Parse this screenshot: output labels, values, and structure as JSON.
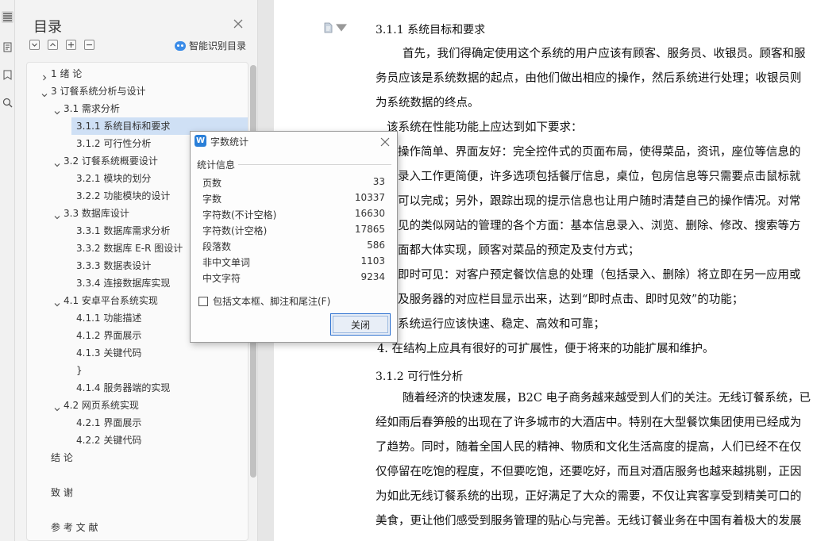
{
  "nav": {
    "title": "目录",
    "smart_label": "智能识别目录"
  },
  "toc": [
    {
      "label": "1  绪  论",
      "level": 0,
      "expanded": false
    },
    {
      "label": "3  订餐系统分析与设计",
      "level": 0,
      "expanded": true
    },
    {
      "label": "3.1 需求分析",
      "level": 1,
      "expanded": true
    },
    {
      "label": "3.1.1  系统目标和要求",
      "level": 2,
      "selected": true
    },
    {
      "label": "3.1.2  可行性分析",
      "level": 2
    },
    {
      "label": "3.2  订餐系统概要设计",
      "level": 1,
      "expanded": true
    },
    {
      "label": "3.2.1  模块的划分",
      "level": 2
    },
    {
      "label": "3.2.2  功能模块的设计",
      "level": 2
    },
    {
      "label": "3.3  数据库设计",
      "level": 1,
      "expanded": true
    },
    {
      "label": "3.3.1  数据库需求分析",
      "level": 2
    },
    {
      "label": "3.3.2  数据库 E-R 图设计",
      "level": 2
    },
    {
      "label": "3.3.3  数据表设计",
      "level": 2
    },
    {
      "label": "3.3.4  连接数据库实现",
      "level": 2
    },
    {
      "label": "4.1 安卓平台系统实现",
      "level": 1,
      "expanded": true
    },
    {
      "label": "4.1.1  功能描述",
      "level": 2
    },
    {
      "label": "4.1.2  界面展示",
      "level": 2
    },
    {
      "label": "4.1.3  关键代码",
      "level": 2
    },
    {
      "label": "}",
      "level": 2
    },
    {
      "label": "4.1.4  服务器端的实现",
      "level": 2
    },
    {
      "label": "4.2  网页系统实现",
      "level": 1,
      "expanded": true
    },
    {
      "label": "4.2.1  界面展示",
      "level": 2
    },
    {
      "label": "4.2.2  关键代码",
      "level": 2
    },
    {
      "label": "结   论",
      "level": 0
    },
    {
      "label": "",
      "level": 0
    },
    {
      "label": "致   谢",
      "level": 0
    },
    {
      "label": "",
      "level": 0
    },
    {
      "label": "参 考 文 献",
      "level": 0
    }
  ],
  "document": {
    "heading1": "3.1.1   系统目标和要求",
    "heading2": "3.1.2   可行性分析",
    "lines_a": [
      "首先，我们得确定使用这个系统的用户应该有顾客、服务员、收银员。顾客和服",
      "务员应该是系统数据的起点，由他们做出相应的操作，然后系统进行处理；收银员则",
      "为系统数据的终点。",
      "该系统在性能功能上应达到如下要求：",
      "操作简单、界面友好：完全控件式的页面布局，使得菜品，资讯，座位等信息的",
      "录入工作更简便，许多选项包括餐厅信息，桌位，包房信息等只需要点击鼠标就",
      "可以完成；另外，跟踪出现的提示信息也让用户随时清楚自己的操作情况。对常",
      "见的类似网站的管理的各个方面：基本信息录入、浏览、删除、修改、搜索等方",
      "面都大体实现，顾客对菜品的预定及支付方式；",
      "即时可见：对客户预定餐饮信息的处理（包括录入、删除）将立即在另一应用或",
      "及服务器的对应栏目显示出来，达到“即时点击、即时见效”的功能；",
      "系统运行应该快速、稳定、高效和可靠；",
      "4.   在结构上应具有很好的可扩展性，便于将来的功能扩展和维护。"
    ],
    "lines_b": [
      "随着经济的快速发展，B2C 电子商务越来越受到人们的关注。无线订餐系统，已",
      "经如雨后春笋般的出现在了许多城市的大酒店中。特别在大型餐饮集团使用已经成为",
      "了趋势。同时，随着全国人民的精神、物质和文化生活高度的提高，人们已经不在仅",
      "仅停留在吃饱的程度，不但要吃饱，还要吃好，而且对酒店服务也越来越挑剔，正因",
      "为如此无线订餐系统的出现，正好满足了大众的需要，不仅让宾客享受到精美可口的",
      "美食，更让他们感受到服务管理的贴心与完善。无线订餐业务在中国有着极大的发展"
    ]
  },
  "dialog": {
    "logo": "W",
    "title": "字数统计",
    "group": "统计信息",
    "stats": [
      {
        "label": "页数",
        "value": "33"
      },
      {
        "label": "字数",
        "value": "10337"
      },
      {
        "label": "字符数(不计空格)",
        "value": "16630"
      },
      {
        "label": "字符数(计空格)",
        "value": "17865"
      },
      {
        "label": "段落数",
        "value": "586"
      },
      {
        "label": "非中文单词",
        "value": "1103"
      },
      {
        "label": "中文字符",
        "value": "9234"
      }
    ],
    "checkbox_label": "包括文本框、脚注和尾注(F)",
    "close_label": "关闭"
  }
}
